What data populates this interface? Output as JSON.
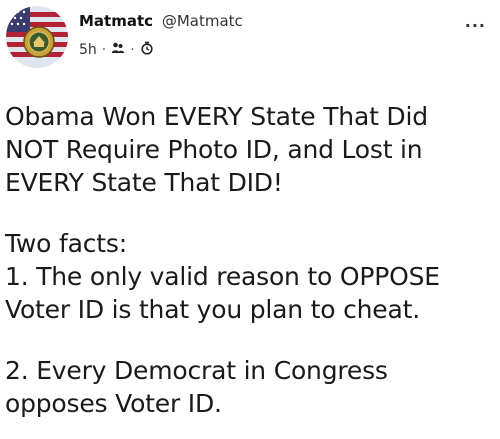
{
  "post": {
    "author": {
      "display_name": "Matmatc",
      "handle": "@Matmatc",
      "avatar_icon": "flag-seal-avatar-icon"
    },
    "meta": {
      "time": "5h",
      "separator": "·",
      "audience_icon": "friends-icon",
      "extra_icon": "custom-list-icon"
    },
    "more_label": "···",
    "text": {
      "paragraph_1": [
        "Obama Won EVERY State That Did",
        "NOT Require Photo ID, and Lost in",
        "EVERY State That DID!"
      ],
      "paragraph_2": [
        "Two facts:",
        "1. The only valid reason to OPPOSE",
        "Voter ID is that you plan to cheat."
      ],
      "paragraph_3": [
        "2. Every Democrat in Congress",
        "opposes Voter ID."
      ]
    }
  },
  "colors": {
    "background": "#ffffff",
    "text": "#1a1a1a"
  }
}
